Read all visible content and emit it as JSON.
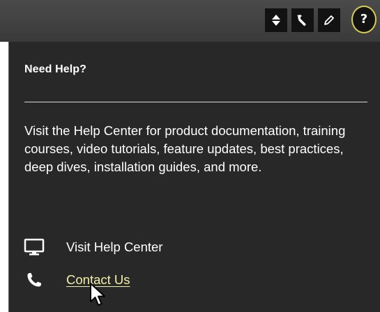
{
  "toolbar": {
    "buttons": [
      {
        "icon": "sort-arrows-icon"
      },
      {
        "icon": "wrench-icon"
      },
      {
        "icon": "pencil-icon"
      }
    ],
    "help_button": {
      "icon": "question-mark-icon",
      "glyph": "?",
      "highlight_color": "#d9cd52"
    }
  },
  "help_panel": {
    "title": "Need Help?",
    "description": "Visit the Help Center for product documentation, training courses, video tutorials, feature updates, best practices, deep dives, installation guides, and more.",
    "links": [
      {
        "icon": "monitor-icon",
        "label": "Visit Help Center"
      },
      {
        "icon": "phone-icon",
        "label": "Contact Us",
        "hovered": true
      }
    ],
    "link_hover_color": "#f2f0a6"
  }
}
